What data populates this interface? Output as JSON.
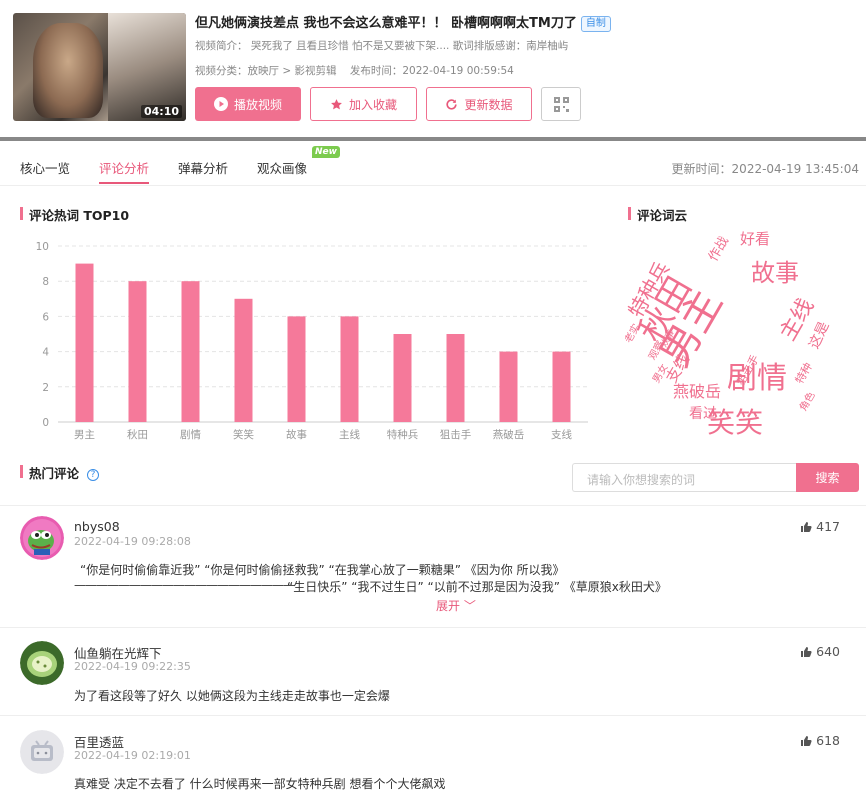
{
  "video": {
    "duration": "04:10",
    "title": "但凡她俩演技差点 我也不会这么意难平！！ 卧槽啊啊啊太TM刀了",
    "tag": "自制",
    "intro_label": "视频简介：",
    "intro_text": "哭死我了 且看且珍惜 怕不是又要被下架.... 歌词排版感谢：南岸柚屿",
    "category_label": "视频分类：",
    "category": "放映厅 > 影视剪辑",
    "publish_label": "发布时间：",
    "publish_time": "2022-04-19 00:59:54"
  },
  "actions": {
    "play": "播放视频",
    "favorite": "加入收藏",
    "update": "更新数据"
  },
  "tabs": [
    "核心一览",
    "评论分析",
    "弹幕分析",
    "观众画像"
  ],
  "new_badge": "New",
  "update_time": "更新时间：2022-04-19 13:45:04",
  "sections": {
    "hotwords": "评论热词 TOP10",
    "wordcloud": "评论词云",
    "hot_comments": "热门评论"
  },
  "chart_data": {
    "type": "bar",
    "title": "评论热词 TOP10",
    "categories": [
      "男主",
      "秋田",
      "剧情",
      "笑笑",
      "故事",
      "主线",
      "特种兵",
      "狙击手",
      "燕破岳",
      "支线"
    ],
    "values": [
      9,
      8,
      8,
      7,
      6,
      6,
      5,
      5,
      4,
      4
    ],
    "ylim": [
      0,
      10
    ],
    "yticks": [
      0,
      2,
      4,
      6,
      8,
      10
    ],
    "color": "#f5799a",
    "grid": true
  },
  "wordcloud": {
    "color": "#f0708f",
    "words": [
      "男主",
      "秋田",
      "剧情",
      "笑笑",
      "故事",
      "主线",
      "特种兵",
      "燕破岳",
      "支线",
      "好看",
      "看过",
      "狙击手",
      "这是",
      "角色",
      "作战",
      "男女",
      "观察",
      "老实",
      "炊事",
      "特种"
    ]
  },
  "search": {
    "placeholder": "请输入你想搜索的词",
    "button": "搜索"
  },
  "comments": [
    {
      "name": "nbys08",
      "time": "2022-04-19 09:28:08",
      "likes": "417",
      "line1": "“你是何时偷偷靠近我” “你是何时偷偷拯救我” “在我掌心放了一颗糖果” 《因为你 所以我》",
      "line2_rule": "————————————————————",
      "line2": "“生日快乐” “我不过生日” “以前不过那是因为没我” 《草原狼x秋田犬》",
      "expand": "展开"
    },
    {
      "name": "仙鱼躺在光辉下",
      "time": "2022-04-19 09:22:35",
      "likes": "640",
      "line1": "为了看这段等了好久 以她俩这段为主线走走故事也一定会爆"
    },
    {
      "name": "百里透蓝",
      "time": "2022-04-19 02:19:01",
      "likes": "618",
      "line1": "真难受 决定不去看了 什么时候再来一部女特种兵剧 想看个个大佬飙戏"
    }
  ]
}
